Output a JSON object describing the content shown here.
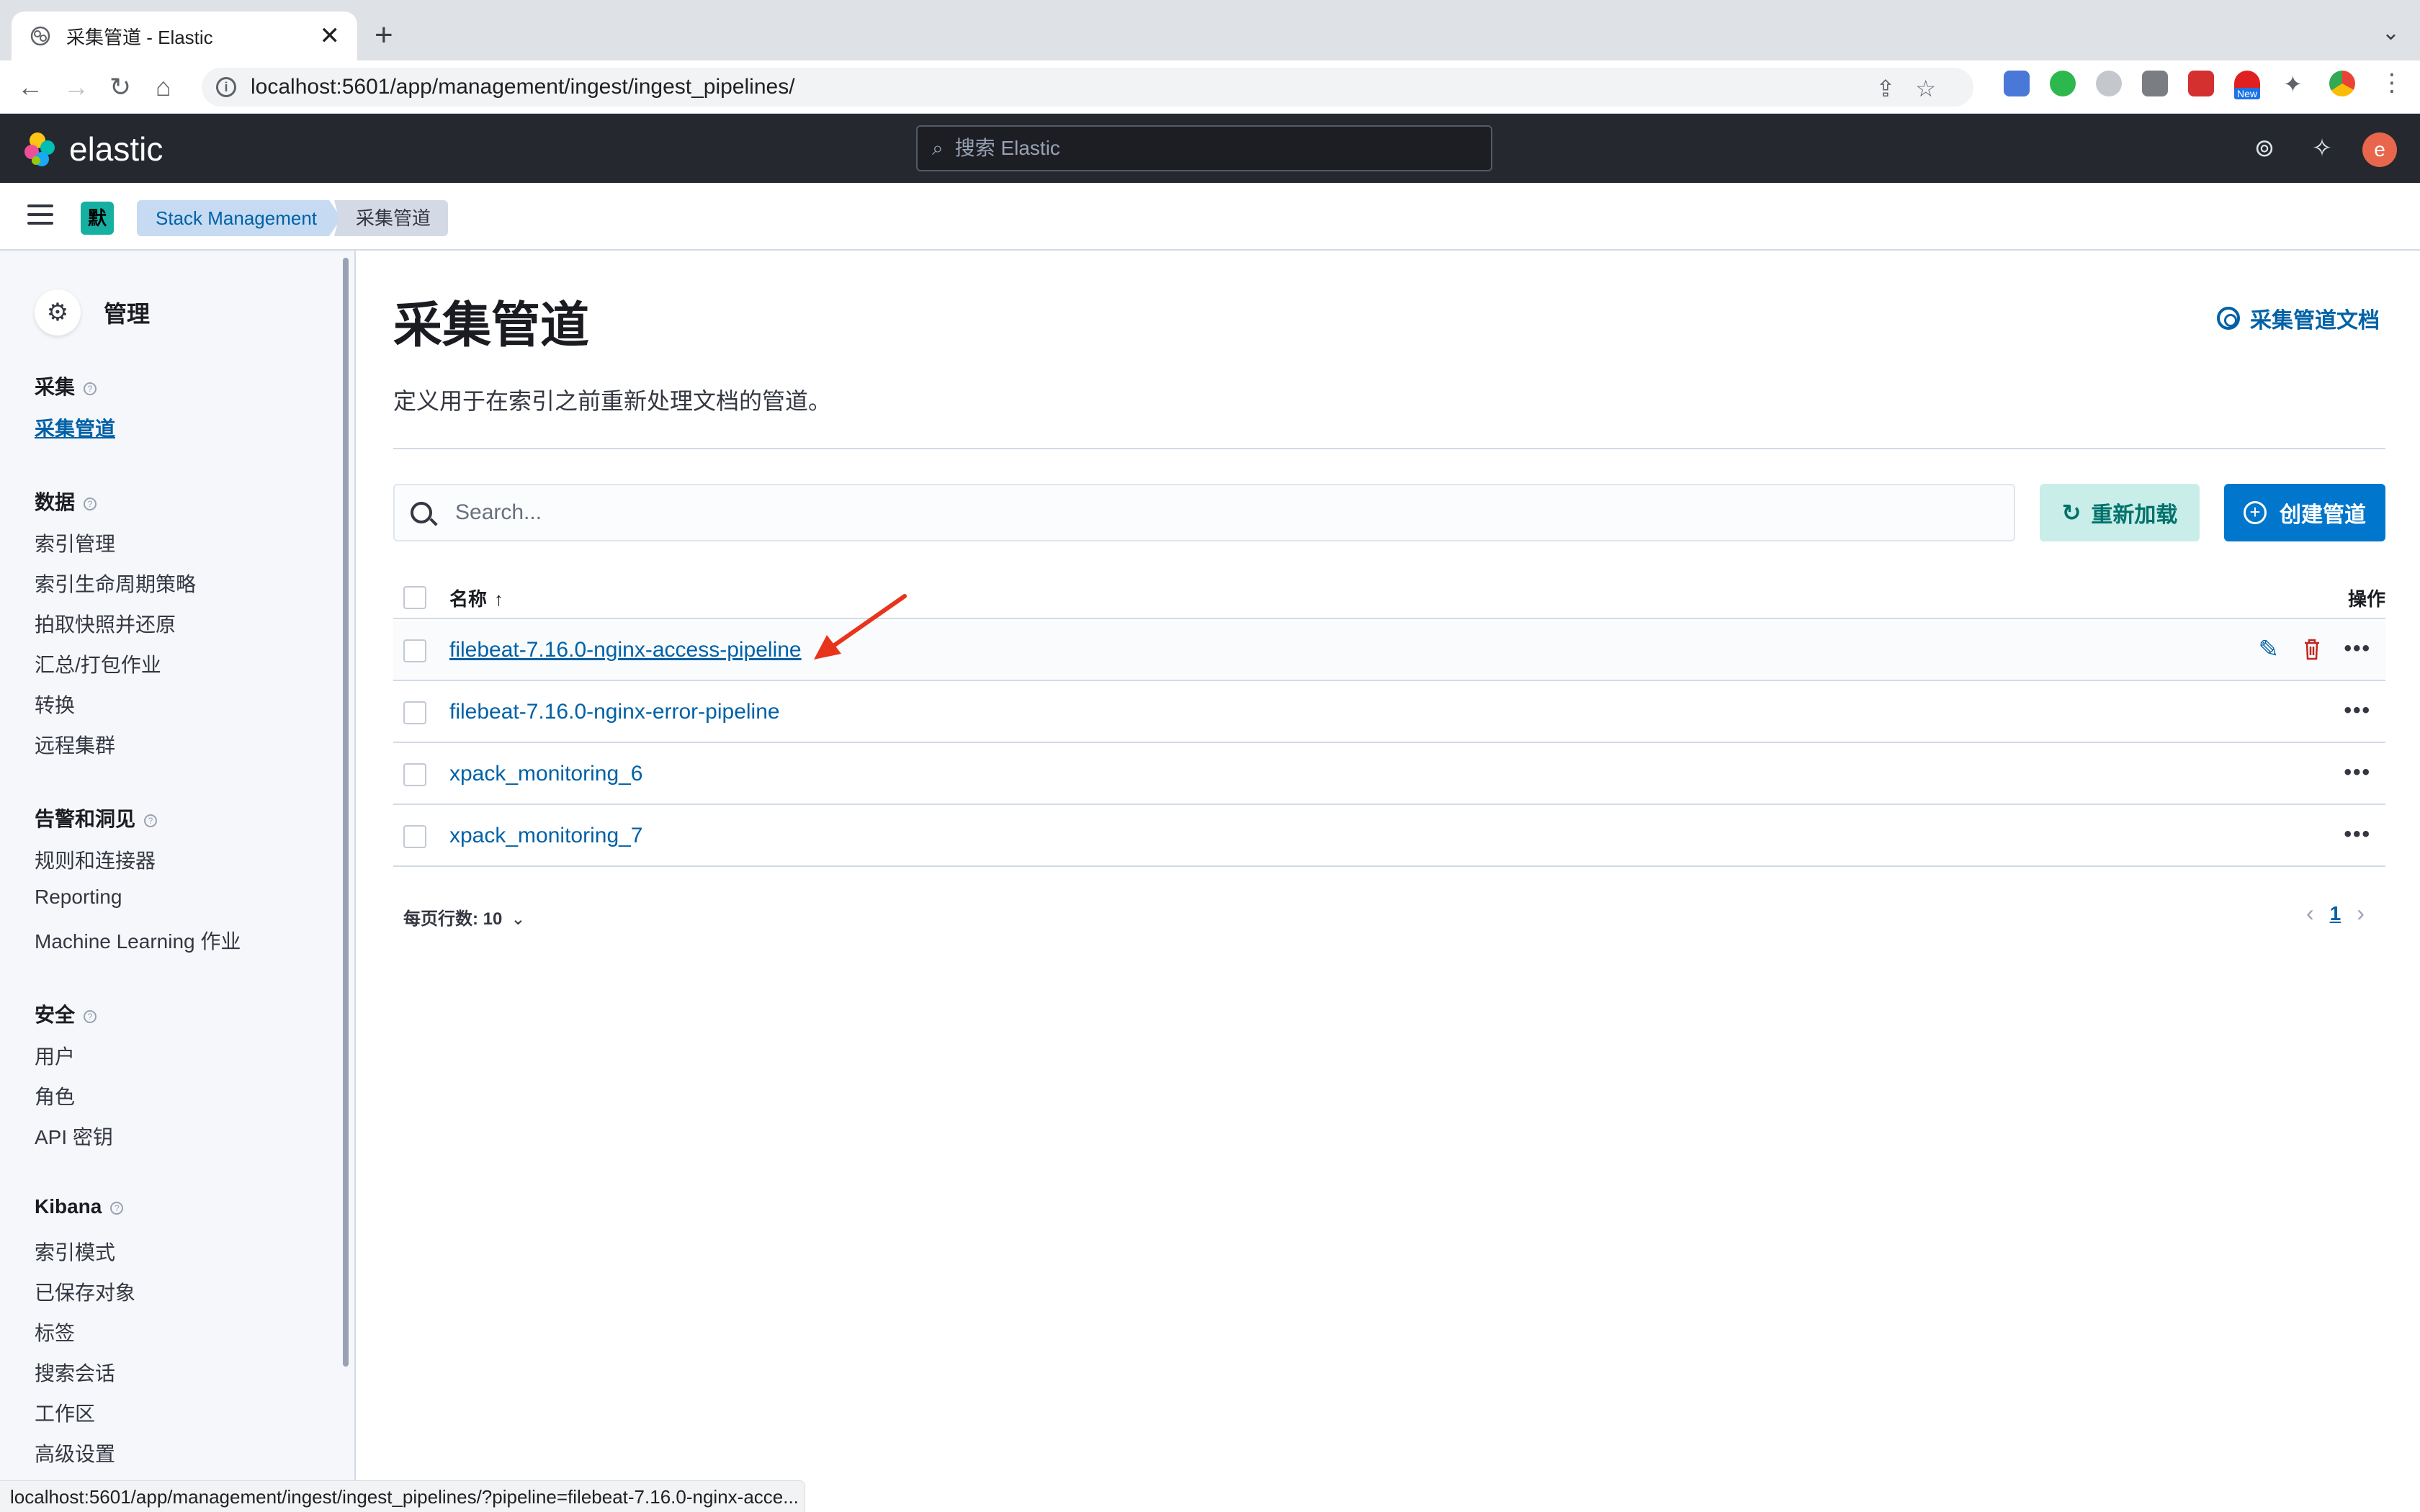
{
  "browser": {
    "tab_title": "采集管道 - Elastic",
    "url": "localhost:5601/app/management/ingest/ingest_pipelines/",
    "status_url": "localhost:5601/app/management/ingest/ingest_pipelines/?pipeline=filebeat-7.16.0-nginx-acce...",
    "new_badge": "New"
  },
  "header": {
    "logo_text": "elastic",
    "search_placeholder": "搜索 Elastic",
    "avatar_letter": "e"
  },
  "breadcrumbs": {
    "space_letter": "默",
    "items": [
      "Stack Management",
      "采集管道"
    ]
  },
  "sidebar": {
    "title": "管理",
    "sections": [
      {
        "label": "采集",
        "items": [
          "采集管道"
        ]
      },
      {
        "label": "数据",
        "items": [
          "索引管理",
          "索引生命周期策略",
          "拍取快照并还原",
          "汇总/打包作业",
          "转换",
          "远程集群"
        ]
      },
      {
        "label": "告警和洞见",
        "items": [
          "规则和连接器",
          "Reporting",
          "Machine Learning 作业"
        ]
      },
      {
        "label": "安全",
        "items": [
          "用户",
          "角色",
          "API 密钥"
        ]
      },
      {
        "label": "Kibana",
        "items": [
          "索引模式",
          "已保存对象",
          "标签",
          "搜索会话",
          "工作区",
          "高级设置"
        ]
      }
    ],
    "active_item": "采集管道"
  },
  "main": {
    "title": "采集管道",
    "doc_link": "采集管道文档",
    "description": "定义用于在索引之前重新处理文档的管道。",
    "search_placeholder": "Search...",
    "reload_button": "重新加载",
    "create_button": "创建管道",
    "table": {
      "col_name": "名称",
      "sort_arrow": "↑",
      "col_actions": "操作",
      "rows": [
        "filebeat-7.16.0-nginx-access-pipeline",
        "filebeat-7.16.0-nginx-error-pipeline",
        "xpack_monitoring_6",
        "xpack_monitoring_7"
      ]
    },
    "rows_per_page": "每页行数: 10",
    "current_page": "1"
  },
  "colors": {
    "accent": "#0077cc",
    "link": "#0061a6",
    "header_bg": "#25282f",
    "annotation": "#e8341c"
  }
}
